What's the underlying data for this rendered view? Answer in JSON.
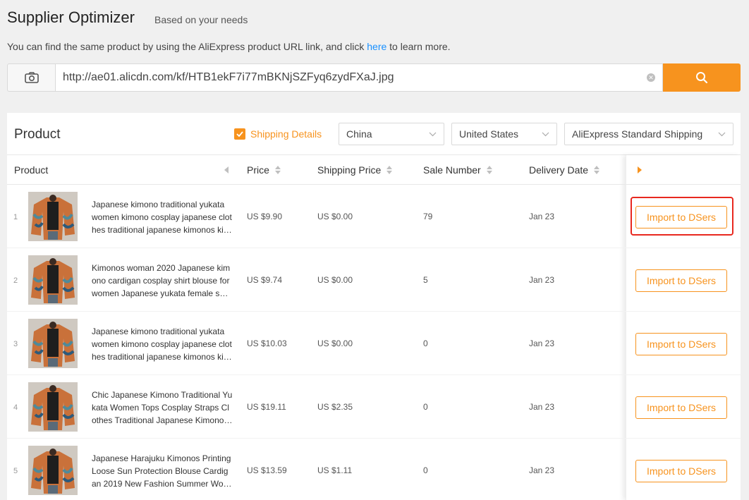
{
  "header": {
    "title": "Supplier Optimizer",
    "subtitle": "Based on your needs",
    "desc_before": "You can find the same product by using the AliExpress product URL link, and click ",
    "desc_link": "here",
    "desc_after": " to learn more."
  },
  "search": {
    "value": "http://ae01.alicdn.com/kf/HTB1ekF7i77mBKNjSZFyq6zydFXaJ.jpg",
    "camera_icon": "camera-icon",
    "clear_icon": "clear-circle-icon",
    "search_icon": "search-icon"
  },
  "panel": {
    "title": "Product",
    "shipping_details_label": "Shipping Details",
    "shipping_details_checked": true,
    "ship_from": "China",
    "ship_to": "United States",
    "shipping_method": "AliExpress Standard Shipping"
  },
  "columns": {
    "product": "Product",
    "price": "Price",
    "shipping_price": "Shipping Price",
    "sale_number": "Sale Number",
    "delivery_date": "Delivery Date"
  },
  "rows": [
    {
      "index": "1",
      "name": "Japanese kimono traditional yukata women kimono cosplay japanese clothes traditional japanese kimonos ki…",
      "price": "US $9.90",
      "shipping": "US $0.00",
      "sales": "79",
      "delivery": "Jan 23",
      "action": "Import to DSers"
    },
    {
      "index": "2",
      "name": "Kimonos woman 2020 Japanese kimono cardigan cosplay shirt blouse for women Japanese yukata female s…",
      "price": "US $9.74",
      "shipping": "US $0.00",
      "sales": "5",
      "delivery": "Jan 23",
      "action": "Import to DSers"
    },
    {
      "index": "3",
      "name": "Japanese kimono traditional yukata women kimono cosplay japanese clothes traditional japanese kimonos ki…",
      "price": "US $10.03",
      "shipping": "US $0.00",
      "sales": "0",
      "delivery": "Jan 23",
      "action": "Import to DSers"
    },
    {
      "index": "4",
      "name": "Chic Japanese Kimono Traditional Yukata Women Tops Cosplay Straps Clothes Traditional Japanese Kimono…",
      "price": "US $19.11",
      "shipping": "US $2.35",
      "sales": "0",
      "delivery": "Jan 23",
      "action": "Import to DSers"
    },
    {
      "index": "5",
      "name": "Japanese Harajuku Kimonos Printing Loose Sun Protection Blouse Cardigan 2019 New Fashion Summer Wo…",
      "price": "US $13.59",
      "shipping": "US $1.11",
      "sales": "0",
      "delivery": "Jan 23",
      "action": "Import to DSers"
    }
  ],
  "colors": {
    "accent": "#f7931e",
    "link": "#1890ff",
    "highlight": "#e8281f"
  }
}
